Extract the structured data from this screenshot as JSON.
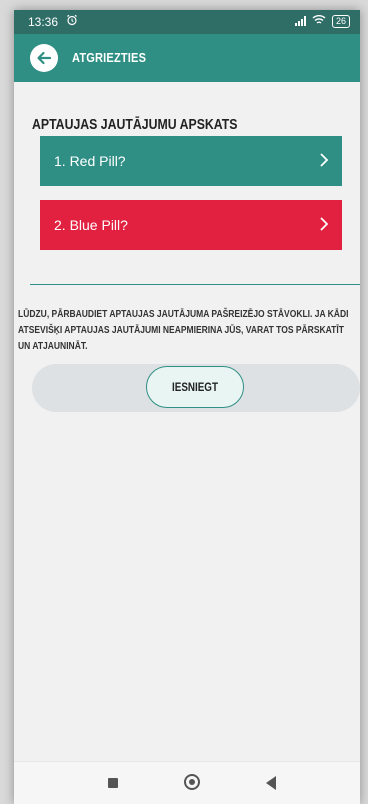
{
  "status_bar": {
    "time": "13:36",
    "alarm_icon": "alarm-clock-icon",
    "wifi_icon": "wifi-icon",
    "battery_level": "26"
  },
  "app_bar": {
    "back_label": "ATGRIEZTIES",
    "back_icon": "arrow-left-icon",
    "color": "#2f8f85"
  },
  "main": {
    "section_title": "APTAUJAS JAUTĀJUMU APSKATS",
    "questions": [
      {
        "label": "1. Red Pill?",
        "color": "#2f8f85",
        "icon": "chevron-right-icon"
      },
      {
        "label": "2. Blue Pill?",
        "color": "#e1213f",
        "icon": "chevron-right-icon"
      }
    ],
    "note": "Lūdzu, pārbaudiet aptaujas jautājuma pašreizējo stāvokli. Ja kādi atsevišķi aptaujas jautājumi neapmierina jūs, varat tos pārskatīt un atjaunināt.",
    "submit_label": "IESNIEGT"
  },
  "nav_bar": {
    "recent_icon": "recent-apps-icon",
    "home_icon": "home-icon",
    "back_icon": "back-triangle-icon"
  }
}
